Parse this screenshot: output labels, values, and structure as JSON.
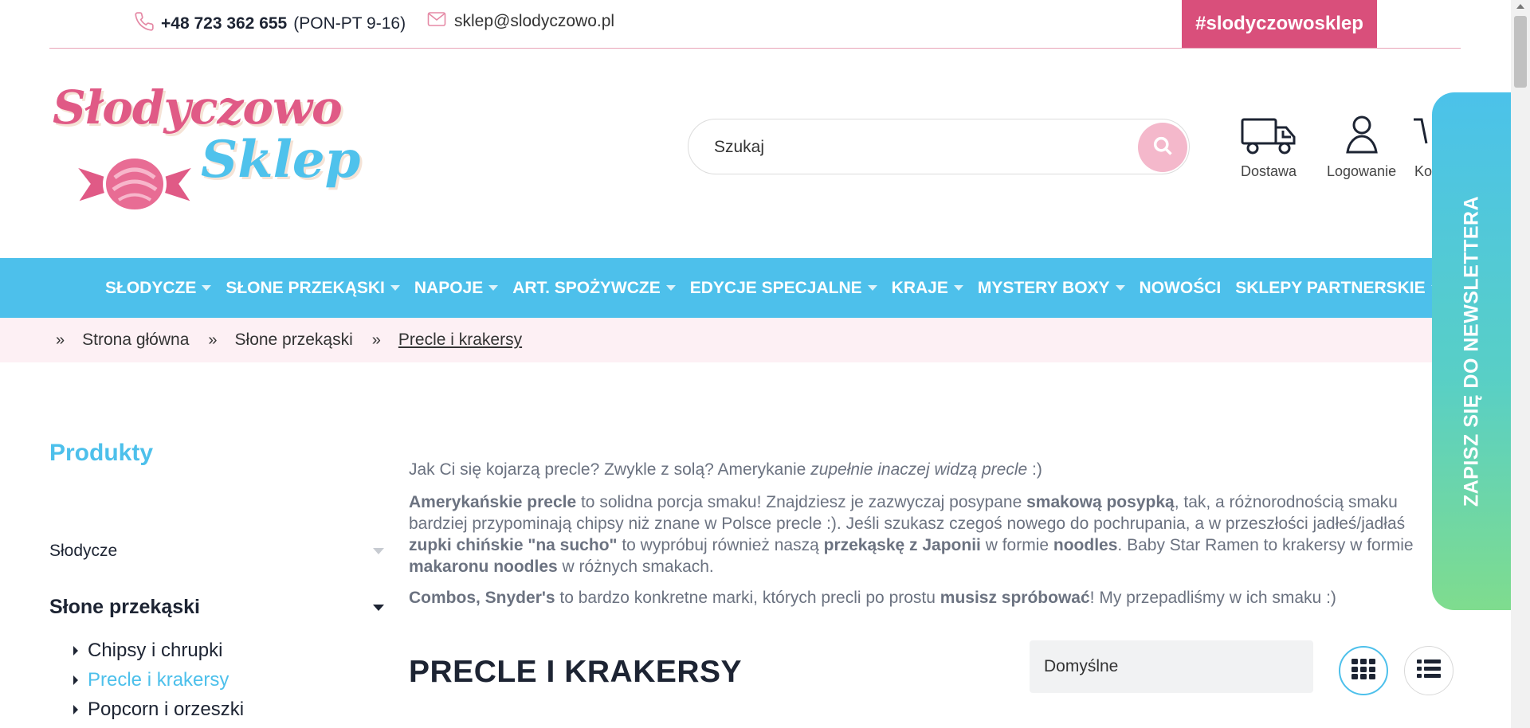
{
  "topbar": {
    "phone": "+48 723 362 655",
    "hours": "(PON-PT 9-16)",
    "email": "sklep@slodyczowo.pl",
    "hashtag": "#slodyczowosklep"
  },
  "logo": {
    "line1": "Słodyczowo",
    "line2": "Sklep"
  },
  "search": {
    "placeholder": "Szukaj"
  },
  "header_icons": {
    "delivery": "Dostawa",
    "login": "Logowanie",
    "cart": "Ko"
  },
  "nav": {
    "items": [
      {
        "label": "SŁODYCZE",
        "dropdown": true
      },
      {
        "label": "SŁONE PRZEKĄSKI",
        "dropdown": true
      },
      {
        "label": "NAPOJE",
        "dropdown": true
      },
      {
        "label": "ART. SPOŻYWCZE",
        "dropdown": true
      },
      {
        "label": "EDYCJE SPECJALNE",
        "dropdown": true
      },
      {
        "label": "KRAJE",
        "dropdown": true
      },
      {
        "label": "MYSTERY BOXY",
        "dropdown": true
      },
      {
        "label": "NOWOŚCI",
        "dropdown": false
      },
      {
        "label": "SKLEPY PARTNERSKIE",
        "dropdown": true
      }
    ]
  },
  "breadcrumb": {
    "separator": "»",
    "items": [
      "Strona główna",
      "Słone przekąski",
      "Precle i krakersy"
    ]
  },
  "sidebar": {
    "title": "Produkty",
    "categories": [
      {
        "label": "Słodycze",
        "expanded": false
      },
      {
        "label": "Słone przekąski",
        "expanded": true
      }
    ],
    "subcategories": [
      {
        "label": "Chipsy i chrupki",
        "active": false
      },
      {
        "label": "Precle i krakersy",
        "active": true
      },
      {
        "label": "Popcorn i orzeszki",
        "active": false
      }
    ]
  },
  "content": {
    "p1_a": "Jak Ci się kojarzą precle? Zwykle z solą? Amerykanie ",
    "p1_em": "zupełnie inaczej widzą precle",
    "p1_b": " :)",
    "p2_b1": "Amerykańskie precle",
    "p2_t1": " to solidna porcja smaku! Znajdziesz je zazwyczaj posypane ",
    "p2_b2": "smakową posypką",
    "p2_t2": ", tak, a różnorodnością smaku bardziej przypominają chipsy niż znane w Polsce precle :). Jeśli szukasz czegoś nowego do pochrupania, a w przeszłości jadłeś/jadłaś ",
    "p2_b3": "zupki chińskie \"na sucho\"",
    "p2_t3": " to wypróbuj również naszą ",
    "p2_b4": "przekąskę z Japonii",
    "p2_t4": " w formie ",
    "p2_b5": "noodles",
    "p2_t5": ". Baby Star Ramen to krakersy w formie ",
    "p2_b6": "makaronu noodles",
    "p2_t6": " w różnych smakach.",
    "p3_b1": "Combos, Snyder's",
    "p3_t1": " to bardzo konkretne marki, których precli po prostu ",
    "p3_b2": "musisz spróbować",
    "p3_t2": "! My przepadliśmy w ich smaku :)"
  },
  "category_heading": "PRECLE I KRAKERSY",
  "sort": {
    "selected": "Domyślne"
  },
  "newsletter": {
    "label": "ZAPISZ SIĘ DO NEWSLETTERA"
  },
  "colors": {
    "brand_pink": "#d94f7b",
    "brand_blue": "#4dc0eb",
    "crumb_bg": "#fdf0f4"
  }
}
